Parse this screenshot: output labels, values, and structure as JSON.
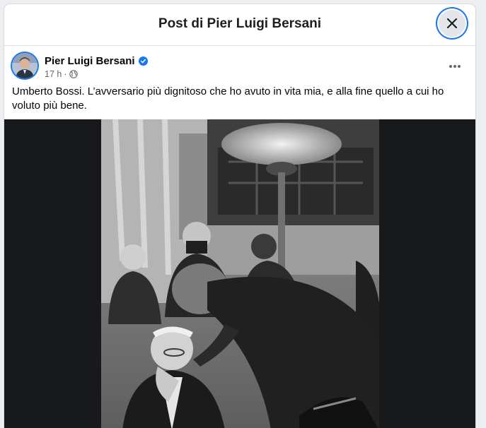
{
  "header": {
    "title": "Post di Pier Luigi Bersani",
    "close_icon": "close-icon"
  },
  "post": {
    "author": "Pier Luigi Bersani",
    "verified_icon": "verified-badge-icon",
    "time": "17 h",
    "separator": "·",
    "audience_icon": "globe-icon",
    "more_icon": "more-options-icon",
    "text": "Umberto Bossi. L’avversario più dignitoso che ho avuto in vita mia, e alla fine quello a cui ho voluto più bene."
  },
  "colors": {
    "accent": "#1877f2",
    "photo_backdrop": "#18191a"
  }
}
